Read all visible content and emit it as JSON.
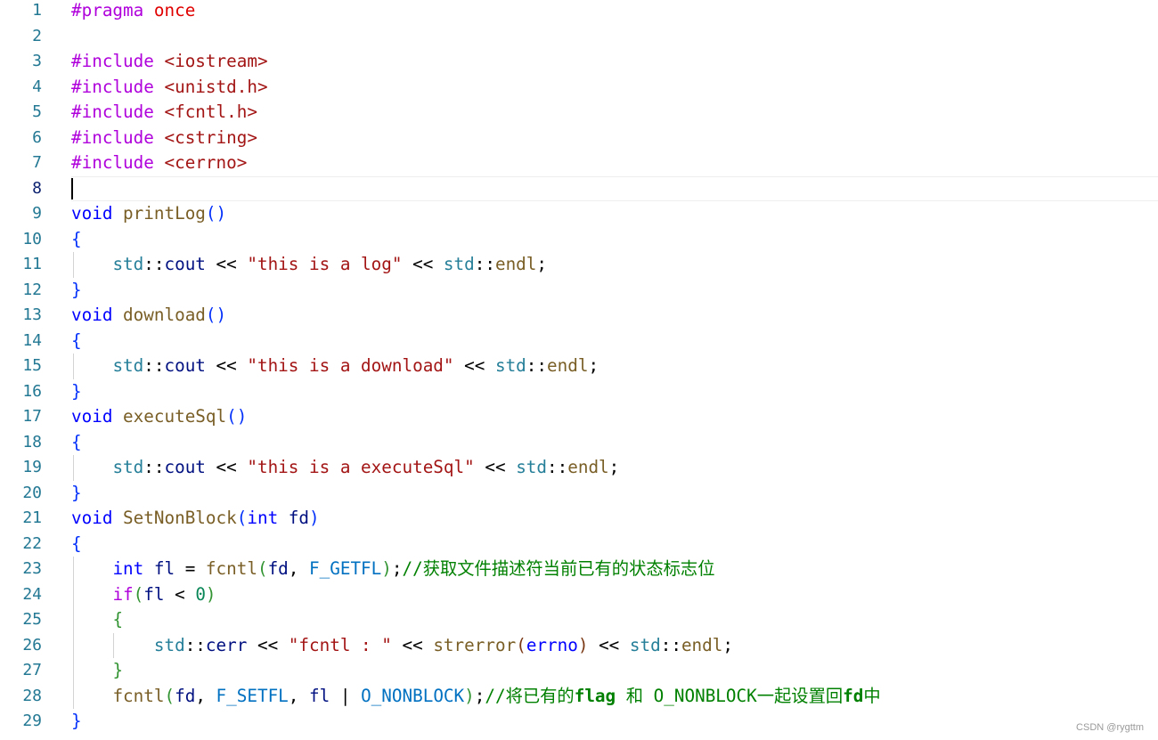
{
  "editor": {
    "current_line": 8,
    "colors": {
      "preprocessor": "#af00db",
      "keyword": "#0000ff",
      "function": "#795e26",
      "namespace": "#267f99",
      "string": "#a31515",
      "variable": "#001080",
      "constant": "#0070c1",
      "number": "#098658",
      "comment": "#008000",
      "line_number": "#237893"
    },
    "lines": [
      [
        [
          "pp",
          "#pragma "
        ],
        [
          "ph",
          "once"
        ]
      ],
      [],
      [
        [
          "pp",
          "#include "
        ],
        [
          "str",
          "<iostream>"
        ]
      ],
      [
        [
          "pp",
          "#include "
        ],
        [
          "str",
          "<unistd.h>"
        ]
      ],
      [
        [
          "pp",
          "#include "
        ],
        [
          "str",
          "<fcntl.h>"
        ]
      ],
      [
        [
          "pp",
          "#include "
        ],
        [
          "str",
          "<cstring>"
        ]
      ],
      [
        [
          "pp",
          "#include "
        ],
        [
          "str",
          "<cerrno>"
        ]
      ],
      [],
      [
        [
          "kw",
          "void "
        ],
        [
          "fn",
          "printLog"
        ],
        [
          "b1",
          "()"
        ]
      ],
      [
        [
          "b1",
          "{"
        ]
      ],
      [
        [
          "tx",
          "    "
        ],
        [
          "ns",
          "std"
        ],
        [
          "tx",
          "::"
        ],
        [
          "var",
          "cout"
        ],
        [
          "tx",
          " << "
        ],
        [
          "str",
          "\"this is a log\""
        ],
        [
          "tx",
          " << "
        ],
        [
          "ns",
          "std"
        ],
        [
          "tx",
          "::"
        ],
        [
          "fn",
          "endl"
        ],
        [
          "tx",
          ";"
        ]
      ],
      [
        [
          "b1",
          "}"
        ]
      ],
      [
        [
          "kw",
          "void "
        ],
        [
          "fn",
          "download"
        ],
        [
          "b1",
          "()"
        ]
      ],
      [
        [
          "b1",
          "{"
        ]
      ],
      [
        [
          "tx",
          "    "
        ],
        [
          "ns",
          "std"
        ],
        [
          "tx",
          "::"
        ],
        [
          "var",
          "cout"
        ],
        [
          "tx",
          " << "
        ],
        [
          "str",
          "\"this is a download\""
        ],
        [
          "tx",
          " << "
        ],
        [
          "ns",
          "std"
        ],
        [
          "tx",
          "::"
        ],
        [
          "fn",
          "endl"
        ],
        [
          "tx",
          ";"
        ]
      ],
      [
        [
          "b1",
          "}"
        ]
      ],
      [
        [
          "kw",
          "void "
        ],
        [
          "fn",
          "executeSql"
        ],
        [
          "b1",
          "()"
        ]
      ],
      [
        [
          "b1",
          "{"
        ]
      ],
      [
        [
          "tx",
          "    "
        ],
        [
          "ns",
          "std"
        ],
        [
          "tx",
          "::"
        ],
        [
          "var",
          "cout"
        ],
        [
          "tx",
          " << "
        ],
        [
          "str",
          "\"this is a executeSql\""
        ],
        [
          "tx",
          " << "
        ],
        [
          "ns",
          "std"
        ],
        [
          "tx",
          "::"
        ],
        [
          "fn",
          "endl"
        ],
        [
          "tx",
          ";"
        ]
      ],
      [
        [
          "b1",
          "}"
        ]
      ],
      [
        [
          "kw",
          "void "
        ],
        [
          "fn",
          "SetNonBlock"
        ],
        [
          "b1",
          "("
        ],
        [
          "kw",
          "int "
        ],
        [
          "var",
          "fd"
        ],
        [
          "b1",
          ")"
        ]
      ],
      [
        [
          "b1",
          "{"
        ]
      ],
      [
        [
          "tx",
          "    "
        ],
        [
          "kw",
          "int "
        ],
        [
          "var",
          "fl"
        ],
        [
          "tx",
          " = "
        ],
        [
          "fn",
          "fcntl"
        ],
        [
          "b2",
          "("
        ],
        [
          "var",
          "fd"
        ],
        [
          "tx",
          ", "
        ],
        [
          "cst",
          "F_GETFL"
        ],
        [
          "b2",
          ")"
        ],
        [
          "tx",
          ";"
        ],
        [
          "cm",
          "//获取文件描述符当前已有的状态标志位"
        ]
      ],
      [
        [
          "tx",
          "    "
        ],
        [
          "ctl",
          "if"
        ],
        [
          "b2",
          "("
        ],
        [
          "var",
          "fl"
        ],
        [
          "tx",
          " < "
        ],
        [
          "num",
          "0"
        ],
        [
          "b2",
          ")"
        ]
      ],
      [
        [
          "tx",
          "    "
        ],
        [
          "b2",
          "{"
        ]
      ],
      [
        [
          "tx",
          "        "
        ],
        [
          "ns",
          "std"
        ],
        [
          "tx",
          "::"
        ],
        [
          "var",
          "cerr"
        ],
        [
          "tx",
          " << "
        ],
        [
          "str",
          "\"fcntl : \""
        ],
        [
          "tx",
          " << "
        ],
        [
          "fn",
          "strerror"
        ],
        [
          "b3",
          "("
        ],
        [
          "kw",
          "errno"
        ],
        [
          "b3",
          ")"
        ],
        [
          "tx",
          " << "
        ],
        [
          "ns",
          "std"
        ],
        [
          "tx",
          "::"
        ],
        [
          "fn",
          "endl"
        ],
        [
          "tx",
          ";"
        ]
      ],
      [
        [
          "tx",
          "    "
        ],
        [
          "b2",
          "}"
        ]
      ],
      [
        [
          "tx",
          "    "
        ],
        [
          "fn",
          "fcntl"
        ],
        [
          "b2",
          "("
        ],
        [
          "var",
          "fd"
        ],
        [
          "tx",
          ", "
        ],
        [
          "cst",
          "F_SETFL"
        ],
        [
          "tx",
          ", "
        ],
        [
          "var",
          "fl"
        ],
        [
          "tx",
          " | "
        ],
        [
          "cst",
          "O_NONBLOCK"
        ],
        [
          "b2",
          ")"
        ],
        [
          "tx",
          ";"
        ],
        [
          "cm",
          "//将已有的"
        ],
        [
          "cmb",
          "flag"
        ],
        [
          "cm",
          " 和 O_NONBLOCK一起设置回"
        ],
        [
          "cmb",
          "fd"
        ],
        [
          "cm",
          "中"
        ]
      ],
      [
        [
          "b1",
          "}"
        ]
      ]
    ]
  },
  "watermark": "CSDN @rygttm"
}
